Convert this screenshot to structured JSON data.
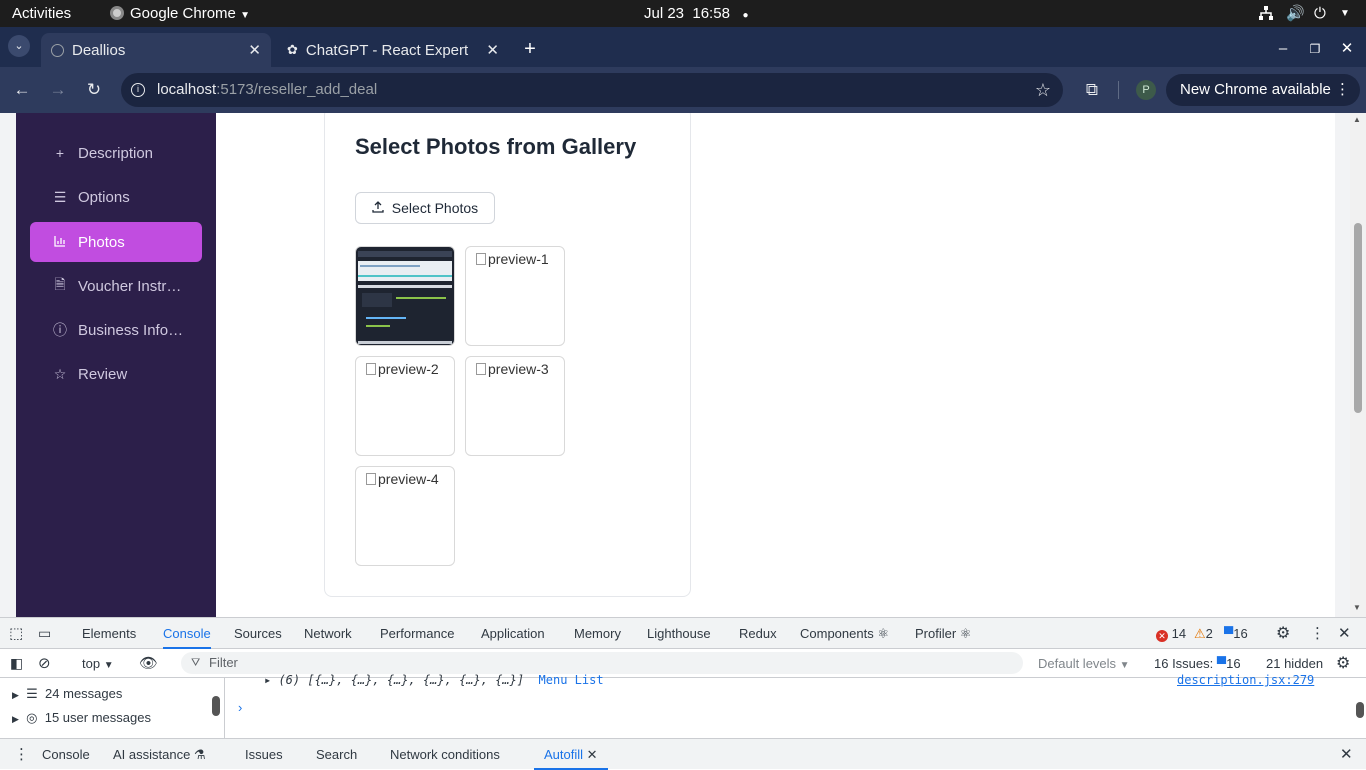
{
  "system": {
    "activities": "Activities",
    "app_name": "Google Chrome",
    "date": "Jul 23",
    "time": "16:58"
  },
  "browser": {
    "tabs": [
      {
        "title": "Deallios",
        "active": true
      },
      {
        "title": "ChatGPT - React Expert",
        "active": false
      }
    ],
    "url_host": "localhost",
    "url_rest": ":5173/reseller_add_deal",
    "profile_initial": "P",
    "update_label": "New Chrome available"
  },
  "sidebar": {
    "items": [
      {
        "label": "Description",
        "icon": "plus-icon"
      },
      {
        "label": "Options",
        "icon": "list-icon"
      },
      {
        "label": "Photos",
        "icon": "chart-icon",
        "active": true
      },
      {
        "label": "Voucher Instru…",
        "icon": "file-icon"
      },
      {
        "label": "Business Infor…",
        "icon": "info-icon"
      },
      {
        "label": "Review",
        "icon": "star-icon"
      }
    ],
    "active_color": "#c14de0",
    "bg_color": "#2c1f4a"
  },
  "main": {
    "heading": "Select Photos from Gallery",
    "select_button": "Select Photos",
    "previews": [
      "preview-1",
      "preview-2",
      "preview-3",
      "preview-4"
    ]
  },
  "devtools": {
    "tabs": [
      "Elements",
      "Console",
      "Sources",
      "Network",
      "Performance",
      "Application",
      "Memory",
      "Lighthouse",
      "Redux",
      "Components ⚛",
      "Profiler ⚛"
    ],
    "active_tab": "Console",
    "errors": "14",
    "warnings": "2",
    "infos": "16",
    "context": "top",
    "filter_placeholder": "Filter",
    "levels": "Default levels",
    "issues_label": "16 Issues:",
    "issues_count": "16",
    "hidden": "21 hidden",
    "sidebar_items": [
      {
        "label": "24 messages"
      },
      {
        "label": "15 user messages"
      }
    ],
    "log_line": "▸ (6) [{…}, {…}, {…}, {…}, {…}, {…}]",
    "log_tag": "Menu List",
    "log_source": "description.jsx:279",
    "drawer_tabs": [
      "Console",
      "AI assistance ⚗",
      "Issues",
      "Search",
      "Network conditions",
      "Autofill"
    ],
    "drawer_active": "Autofill"
  }
}
